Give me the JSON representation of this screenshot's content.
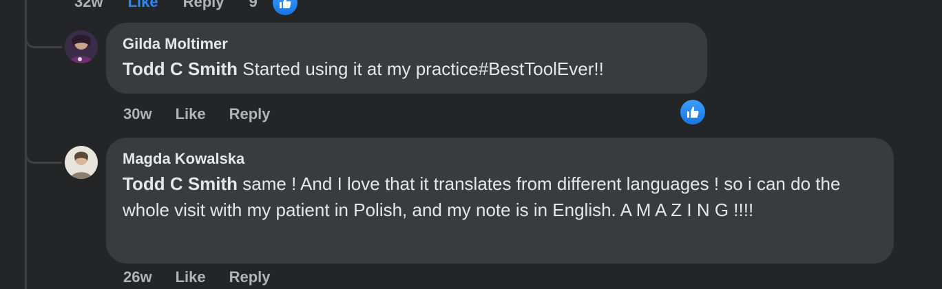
{
  "previous_comment": {
    "time": "32w",
    "like_label": "Like",
    "reply_label": "Reply",
    "reaction_count": "9",
    "reaction_icon": "thumbs-up-icon"
  },
  "comments": [
    {
      "author": "Gilda Moltimer",
      "mention": "Todd C Smith",
      "text": " Started using it at my practice#BestToolEver!!",
      "time": "30w",
      "like_label": "Like",
      "reply_label": "Reply",
      "reaction_icon": "thumbs-up-icon"
    },
    {
      "author": "Magda Kowalska",
      "mention": "Todd C Smith",
      "text": " same ! And I love that it translates from different languages ! so i can do the whole visit with my patient in Polish, and my note is in English. A M A Z I N G !!!!",
      "time": "26w",
      "like_label": "Like",
      "reply_label": "Reply"
    }
  ],
  "colors": {
    "background": "#242526",
    "bubble": "#3a3b3c",
    "text": "#e4e6eb",
    "muted": "#b0b3b8",
    "like_blue": "#2d88ff"
  }
}
